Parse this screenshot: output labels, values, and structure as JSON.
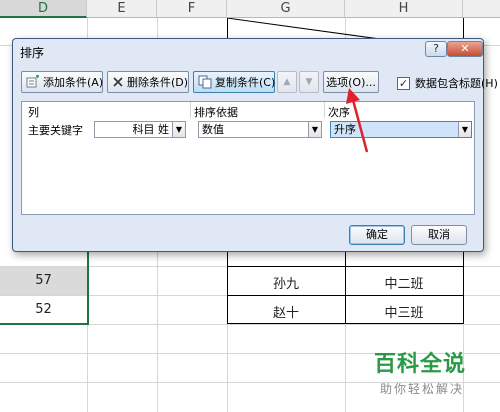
{
  "sheet": {
    "columns": [
      {
        "letter": "D",
        "selected": true
      },
      {
        "letter": "E",
        "selected": false
      },
      {
        "letter": "F",
        "selected": false
      },
      {
        "letter": "G",
        "selected": false
      },
      {
        "letter": "H",
        "selected": false
      }
    ],
    "d_values": [
      "57",
      "52"
    ],
    "g_values": [
      "孙九",
      "赵十"
    ],
    "h_values": [
      "中二班",
      "中三班"
    ]
  },
  "dialog": {
    "title": "排序",
    "help_glyph": "?",
    "close_glyph": "✕",
    "toolbar": {
      "add_label": "添加条件(A)",
      "delete_label": "删除条件(D)",
      "copy_label": "复制条件(C)",
      "up_glyph": "▲",
      "down_glyph": "▼",
      "options_label": "选项(O)...",
      "header_checkbox_label": "数据包含标题(H)",
      "header_checkbox_checked": true
    },
    "grid": {
      "col_header_label": "列",
      "sort_on_header_label": "排序依据",
      "order_header_label": "次序",
      "row_label": "主要关键字",
      "column_value": "科目 姓",
      "sort_on_value": "数值",
      "order_value": "升序"
    },
    "ok_label": "确定",
    "cancel_label": "取消"
  },
  "watermark": {
    "main": "百科全说",
    "sub": "助你轻松解决"
  },
  "colors": {
    "excel_green": "#217346",
    "arrow_red": "#e0202a",
    "watermark_green": "#2b9a48"
  }
}
